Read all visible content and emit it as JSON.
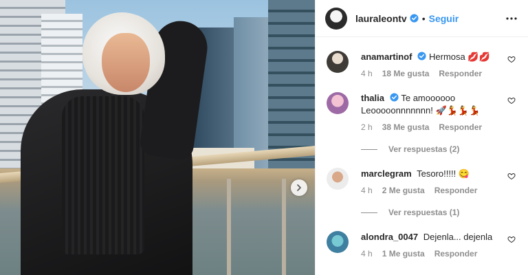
{
  "post": {
    "photo_alt": "",
    "next_icon": "chevron-right-icon"
  },
  "header": {
    "username": "lauraleontv",
    "separator": "•",
    "follow_label": "Seguir",
    "more_icon": "more-options-icon"
  },
  "colors": {
    "link_blue": "#3897f0",
    "verified_blue": "#3897f0",
    "muted": "#8e8e8e",
    "text": "#262626"
  },
  "comments": [
    {
      "username": "anamartinof",
      "verified": true,
      "text": "Hermosa",
      "emoji": "💋💋",
      "time": "4 h",
      "likes": "18 Me gusta",
      "reply_label": "Responder",
      "view_replies": null
    },
    {
      "username": "thalia",
      "verified": true,
      "text": "Te amoooooo Leooooonnnnnnn!",
      "emoji": "🚀💃💃💃",
      "time": "2 h",
      "likes": "38 Me gusta",
      "reply_label": "Responder",
      "view_replies": "Ver respuestas (2)"
    },
    {
      "username": "marclegram",
      "verified": false,
      "text": "Tesoro!!!!!",
      "emoji": "😋",
      "time": "4 h",
      "likes": "2 Me gusta",
      "reply_label": "Responder",
      "view_replies": "Ver respuestas (1)"
    },
    {
      "username": "alondra_0047",
      "verified": false,
      "text": "Dejenla... dejenla",
      "emoji": "",
      "time": "4 h",
      "likes": "1 Me gusta",
      "reply_label": "Responder",
      "view_replies": null
    }
  ]
}
